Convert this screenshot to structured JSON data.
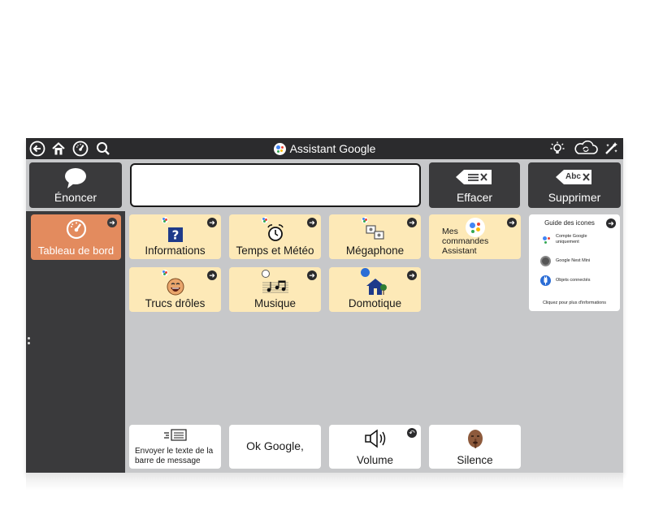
{
  "topbar": {
    "title": "Assistant Google",
    "left_icons": [
      "back-arrow-icon",
      "home-icon",
      "dashboard-gauge-icon",
      "search-icon"
    ],
    "right_icons": [
      "brightness-icon",
      "cloud-sync-icon",
      "edit-wand-icon"
    ]
  },
  "header": {
    "speak_label": "Énoncer",
    "message_bar_value": "",
    "clear_label": "Effacer",
    "delete_label": "Supprimer",
    "delete_icon_text": "Abc"
  },
  "sidebar": {
    "dashboard_label": "Tableau de bord"
  },
  "tiles": {
    "informations": "Informations",
    "temps": "Temps et Météo",
    "megaphone": "Mégaphone",
    "commandes": "Mes commandes Assistant",
    "trucs": "Trucs drôles",
    "musique": "Musique",
    "domotique": "Domotique"
  },
  "guide": {
    "title": "Guide des icones",
    "items": [
      {
        "text": "Compte Google uniquement",
        "icon": "google-assistant-icon"
      },
      {
        "text": "Google Nest Mini",
        "icon": "nest-mini-icon"
      },
      {
        "text": "Objets connectés",
        "icon": "connected-plug-icon"
      }
    ],
    "footer": "Cliquez pour plus d'informations"
  },
  "bottom": {
    "send_text": "Envoyer le texte de la barre de message",
    "ok_google": "Ok Google,",
    "volume": "Volume",
    "silence": "Silence"
  },
  "colors": {
    "app_background": "#c7c8ca",
    "dark_panel": "#3a3a3c",
    "topbar": "#2b2b2d",
    "category_tile": "#fde9b7",
    "dashboard_tile": "#e38b5e",
    "google_blue": "#4285f4",
    "google_red": "#ea4335",
    "google_yellow": "#fbbc05",
    "google_green": "#34a853"
  }
}
